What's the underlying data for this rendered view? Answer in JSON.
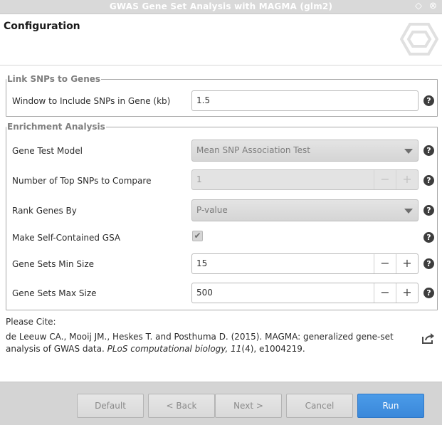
{
  "window": {
    "title": "GWAS Gene Set Analysis with MAGMA (glm2)",
    "restore_icon": "◇",
    "close_icon": "⊗"
  },
  "header": {
    "heading": "Configuration"
  },
  "link_snps": {
    "legend": "Link SNPs to Genes",
    "window_label": "Window to Include SNPs in Gene (kb)",
    "window_value": "1.5"
  },
  "enrichment": {
    "legend": "Enrichment Analysis",
    "gene_test_label": "Gene Test Model",
    "gene_test_value": "Mean SNP Association Test",
    "top_snps_label": "Number of Top SNPs to Compare",
    "top_snps_value": "1",
    "rank_label": "Rank Genes By",
    "rank_value": "P-value",
    "self_contained_label": "Make Self-Contained GSA",
    "self_contained_checked": true,
    "min_size_label": "Gene Sets Min Size",
    "min_size_value": "15",
    "max_size_label": "Gene Sets Max Size",
    "max_size_value": "500"
  },
  "help_symbol": "?",
  "spin": {
    "minus": "−",
    "plus": "+"
  },
  "check_mark": "✔",
  "citation": {
    "heading": "Please Cite:",
    "authors": "de Leeuw CA., Mooij JM., Heskes T. and Posthuma D. (2015). MAGMA: generalized gene-set analysis of GWAS data.",
    "journal": "PLoS computational biology,",
    "volume": "11",
    "issue": "(4), e1004219."
  },
  "footer": {
    "default_label": "Default",
    "back_label": "< Back",
    "next_label": "Next >",
    "cancel_label": "Cancel",
    "run_label": "Run"
  },
  "colors": {
    "accent": "#3a88da",
    "footer_bg": "#d4d4d4",
    "titlebar_bg": "#d9d9d9"
  }
}
